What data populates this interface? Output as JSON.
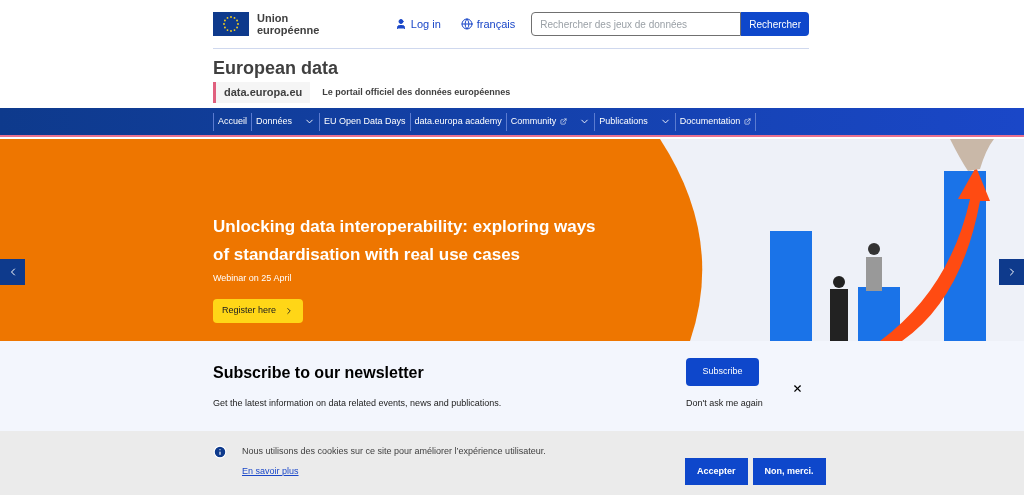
{
  "header": {
    "logo_text": "Union européenne",
    "login": "Log in",
    "language": "français",
    "search": {
      "placeholder": "Rechercher des jeux de données",
      "button": "Rechercher"
    }
  },
  "site": {
    "title": "European data",
    "domain": "data.europa.eu",
    "tagline": "Le portail officiel des données européennes"
  },
  "nav": [
    {
      "label": "Accueil",
      "dropdown": false,
      "external": false
    },
    {
      "label": "Données",
      "dropdown": true,
      "external": false
    },
    {
      "label": "EU Open Data Days",
      "dropdown": false,
      "external": false
    },
    {
      "label": "data.europa academy",
      "dropdown": false,
      "external": false
    },
    {
      "label": "Community",
      "dropdown": true,
      "external": true
    },
    {
      "label": "Publications",
      "dropdown": true,
      "external": false
    },
    {
      "label": "Documentation",
      "dropdown": false,
      "external": true
    }
  ],
  "hero": {
    "title": "Unlocking data interoperability: exploring ways of standardisation with real use cases",
    "subtitle": "Webinar on 25 April",
    "button": "Register here"
  },
  "newsletter": {
    "title": "Subscribe to our newsletter",
    "text": "Get the latest information on data related events, news and publications.",
    "button": "Subscribe",
    "dismiss": "Don't ask me again"
  },
  "cookie": {
    "text": "Nous utilisons des cookies sur ce site pour améliorer l’expérience utilisateur.",
    "link": "En savoir plus",
    "buttons": [
      "Accepter",
      "Non, merci."
    ]
  }
}
